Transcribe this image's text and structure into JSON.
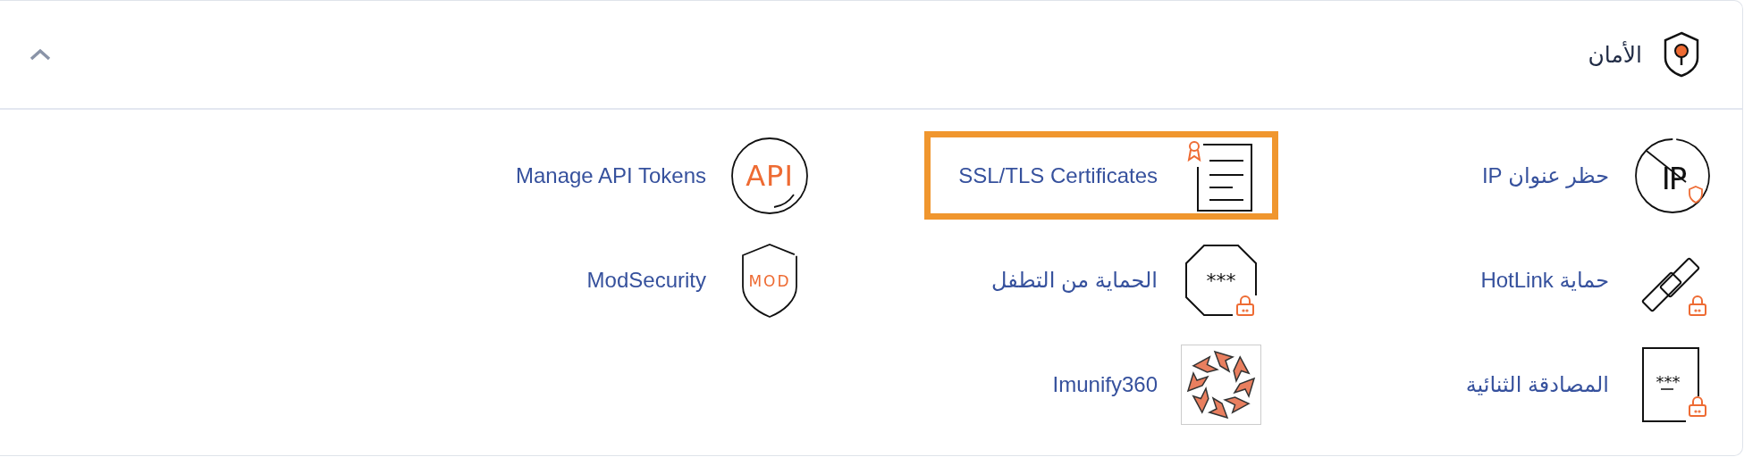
{
  "section": {
    "title": "الأمان",
    "expanded": true
  },
  "items": [
    {
      "label": "حظر عنوان IP",
      "kind": "ip-block",
      "icon_text": "IP",
      "highlighted": false
    },
    {
      "label": "SSL/TLS Certificates",
      "kind": "certificate",
      "highlighted": true
    },
    {
      "label": "Manage API Tokens",
      "kind": "api",
      "icon_text": "API",
      "highlighted": false
    },
    {
      "label": "حماية HotLink",
      "kind": "hotlink",
      "highlighted": false
    },
    {
      "label": "الحماية من التطفل",
      "kind": "password",
      "icon_text": "***",
      "highlighted": false
    },
    {
      "label": "ModSecurity",
      "kind": "modsecurity",
      "icon_text": "MOD",
      "highlighted": false
    },
    {
      "label": "المصادقة الثنائية",
      "kind": "two-factor",
      "icon_text": "***",
      "highlighted": false
    },
    {
      "label": "Imunify360",
      "kind": "imunify",
      "highlighted": false
    }
  ]
}
